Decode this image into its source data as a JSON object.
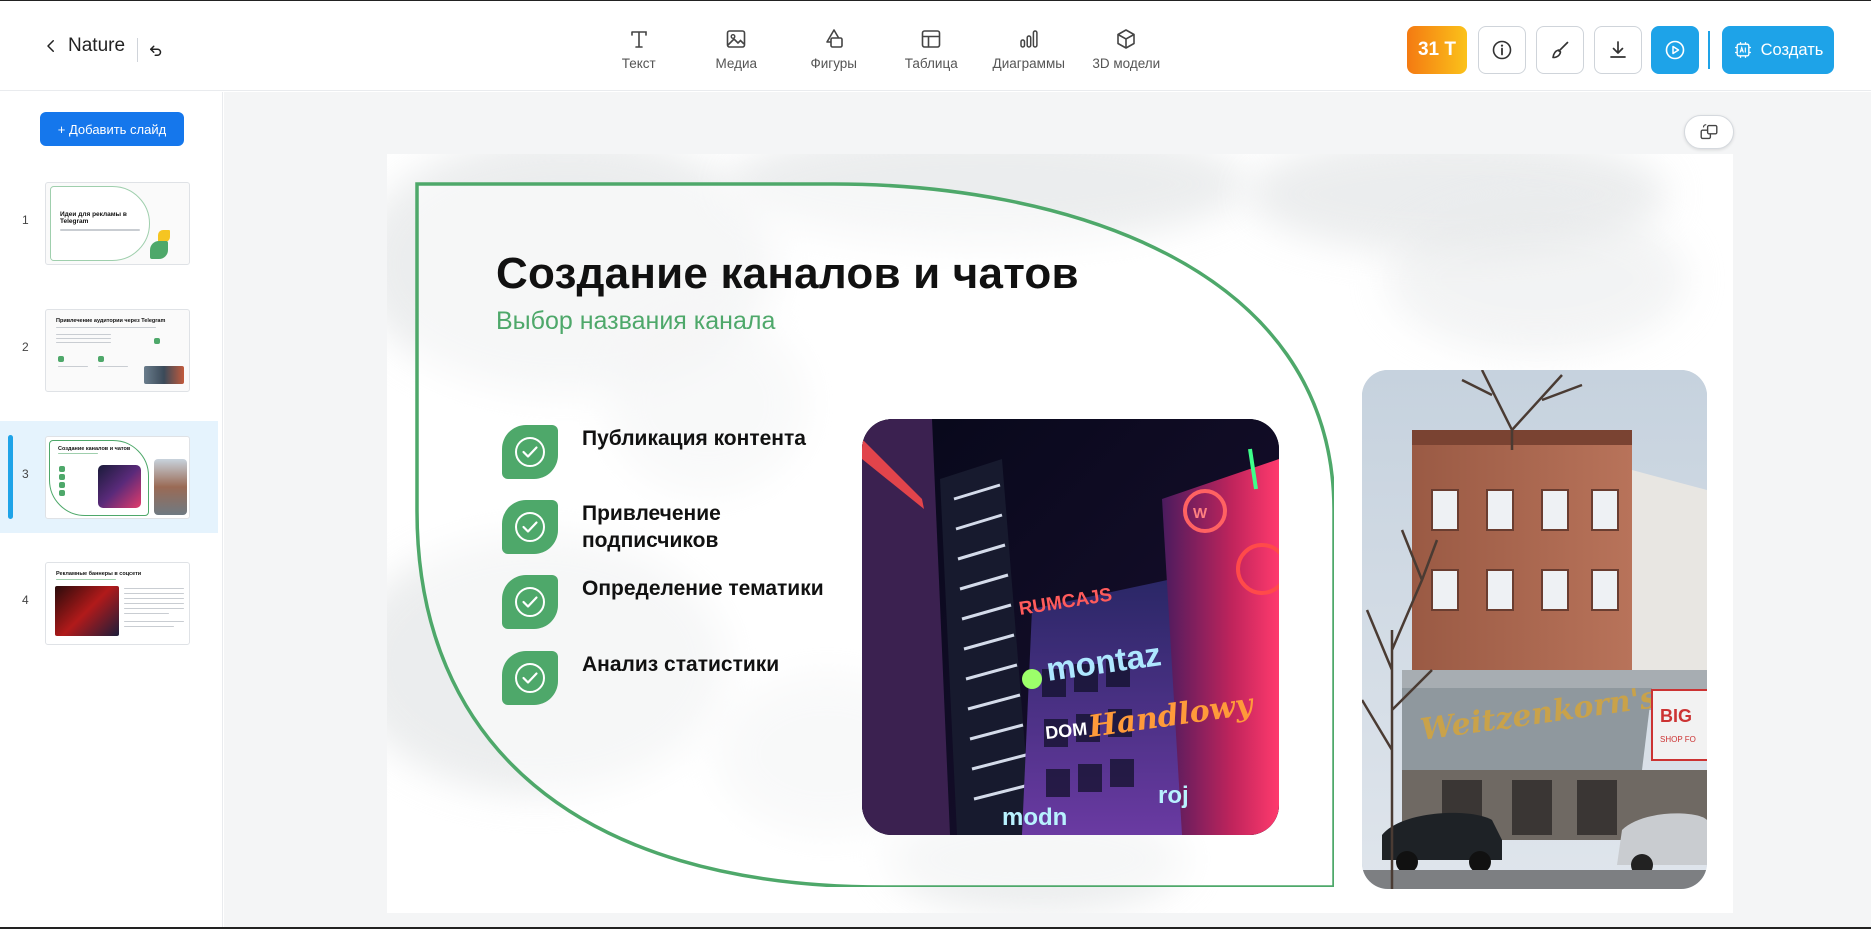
{
  "header": {
    "back_label": "Nature",
    "tools": [
      {
        "label": "Текст",
        "icon": "text-icon"
      },
      {
        "label": "Медиа",
        "icon": "media-icon"
      },
      {
        "label": "Фигуры",
        "icon": "shapes-icon"
      },
      {
        "label": "Таблица",
        "icon": "table-icon"
      },
      {
        "label": "Диаграммы",
        "icon": "chart-icon"
      },
      {
        "label": "3D модели",
        "icon": "cube-icon"
      }
    ],
    "tokens": "31 T",
    "create_label": "Создать"
  },
  "sidebar": {
    "add_slide_label": "+ Добавить слайд",
    "slides": [
      {
        "number": "1",
        "title": "Идеи для рекламы в Telegram"
      },
      {
        "number": "2",
        "title": "Привлечение аудитории через Telegram"
      },
      {
        "number": "3",
        "title": "Создание каналов и чатов",
        "active": true
      },
      {
        "number": "4",
        "title": "Рекламные баннеры в соцсети"
      }
    ]
  },
  "slide": {
    "title": "Создание каналов и чатов",
    "subtitle": "Выбор названия канала",
    "bullets": [
      "Публикация контента",
      "Привлечение подписчиков",
      "Определение тематики",
      "Анализ статистики"
    ],
    "neon_signs": [
      "montaz",
      "DOM",
      "Handlowy",
      "RUMCAJS",
      "modn",
      "roj"
    ],
    "street_signs": [
      "Weitzenkorn's",
      "BIG",
      "SHOP FO"
    ]
  },
  "colors": {
    "accent_green": "#4ea86a",
    "accent_blue": "#1ea3e8",
    "add_button_blue": "#1577ec",
    "token_gradient": [
      "#f47a12",
      "#fbc21a"
    ]
  }
}
